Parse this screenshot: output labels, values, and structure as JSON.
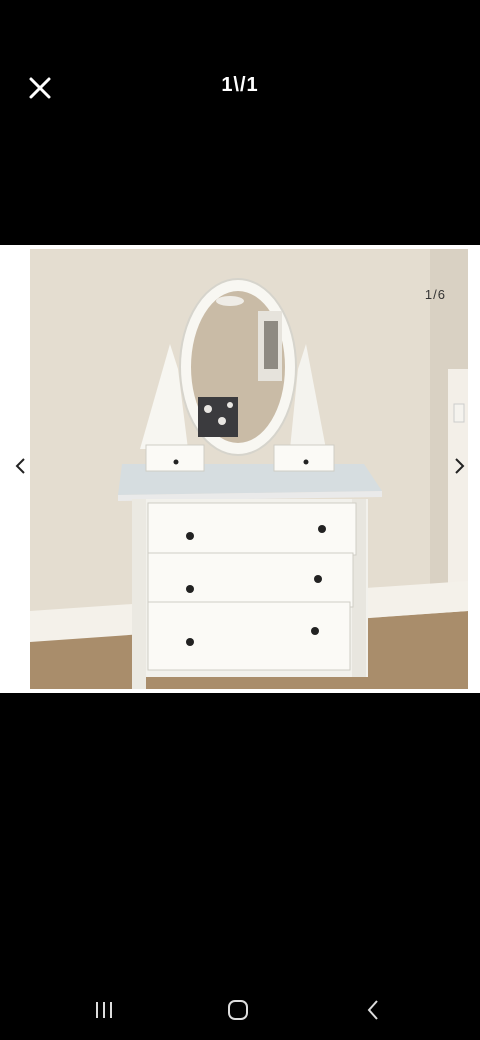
{
  "header": {
    "close_icon": "close-icon",
    "counter": "1\\/1"
  },
  "photo": {
    "counter": "1/6",
    "prev_icon": "chevron-left-icon",
    "next_icon": "chevron-right-icon"
  },
  "system_nav": {
    "recent_icon": "recent-apps-icon",
    "home_icon": "home-icon",
    "back_icon": "back-icon"
  }
}
